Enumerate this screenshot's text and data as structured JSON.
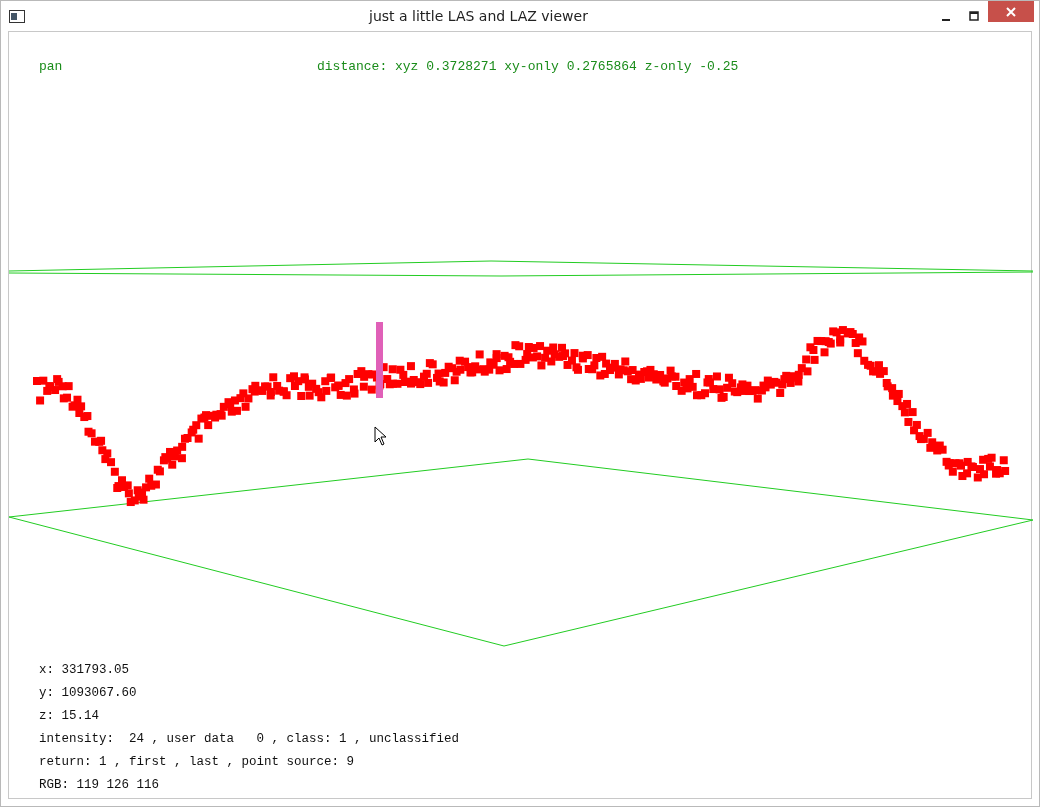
{
  "window": {
    "title": "just a little LAS and LAZ viewer"
  },
  "viewer": {
    "mode": "pan",
    "distance": "distance: xyz 0.3728271 xy-only 0.2765864 z-only -0.25",
    "info_lines": [
      "x: 331793.05",
      "y: 1093067.60",
      "z: 15.14",
      "intensity:  24 , user data   0 , class: 1 , unclassified",
      "return: 1 , first , last , point source: 9",
      "RGB: 119 126 116"
    ]
  }
}
